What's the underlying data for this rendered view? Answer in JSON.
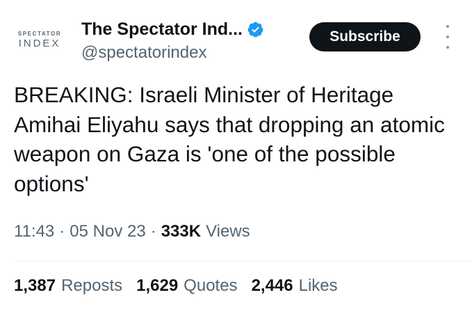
{
  "account": {
    "avatar_top": "SPECTATOR",
    "avatar_bottom": "INDEX",
    "display_name": "The Spectator Ind...",
    "handle": "@spectatorindex",
    "verified_icon": "verified-badge-icon",
    "verified_color": "#1d9bf0"
  },
  "subscribe_label": "Subscribe",
  "more_icon": "more-vertical-icon",
  "tweet_text": "BREAKING: Israeli Minister of Heritage Amihai Eliyahu says that dropping an atomic weapon on Gaza is 'one of the possible options'",
  "meta": {
    "time": "11:43",
    "separator": "·",
    "date": "05 Nov 23",
    "views_count": "333K",
    "views_label": "Views"
  },
  "stats": [
    {
      "count": "1,387",
      "label": "Reposts"
    },
    {
      "count": "1,629",
      "label": "Quotes"
    },
    {
      "count": "2,446",
      "label": "Likes"
    }
  ]
}
